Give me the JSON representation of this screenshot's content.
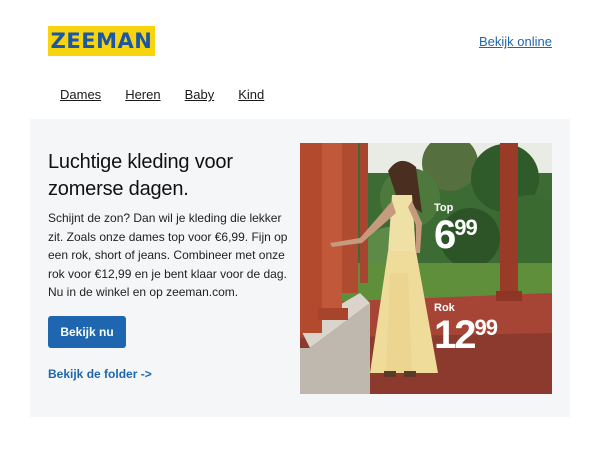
{
  "header": {
    "logo_text": "ZEEMAN",
    "view_online": "Bekijk online"
  },
  "nav": {
    "items": [
      "Dames",
      "Heren",
      "Baby",
      "Kind"
    ]
  },
  "hero": {
    "title": "Luchtige kleding voor zomerse dagen.",
    "body": "Schijnt de zon? Dan wil je kleding die lekker zit. Zoals onze dames top voor €6,99. Fijn op een rok, short of jeans. Combineer met onze rok voor €12,99 en je bent klaar voor de dag. Nu in de winkel en op zeeman.com.",
    "cta": "Bekijk nu",
    "folder_link": "Bekijk de folder ->"
  },
  "prices": {
    "top": {
      "label": "Top",
      "euros": "6",
      "cents": "99"
    },
    "rok": {
      "label": "Rok",
      "euros": "12",
      "cents": "99"
    }
  },
  "colors": {
    "brand_yellow": "#f7d40d",
    "brand_blue": "#1a57a8",
    "link_blue": "#1e66b0",
    "hero_bg": "#f4f6f8"
  }
}
